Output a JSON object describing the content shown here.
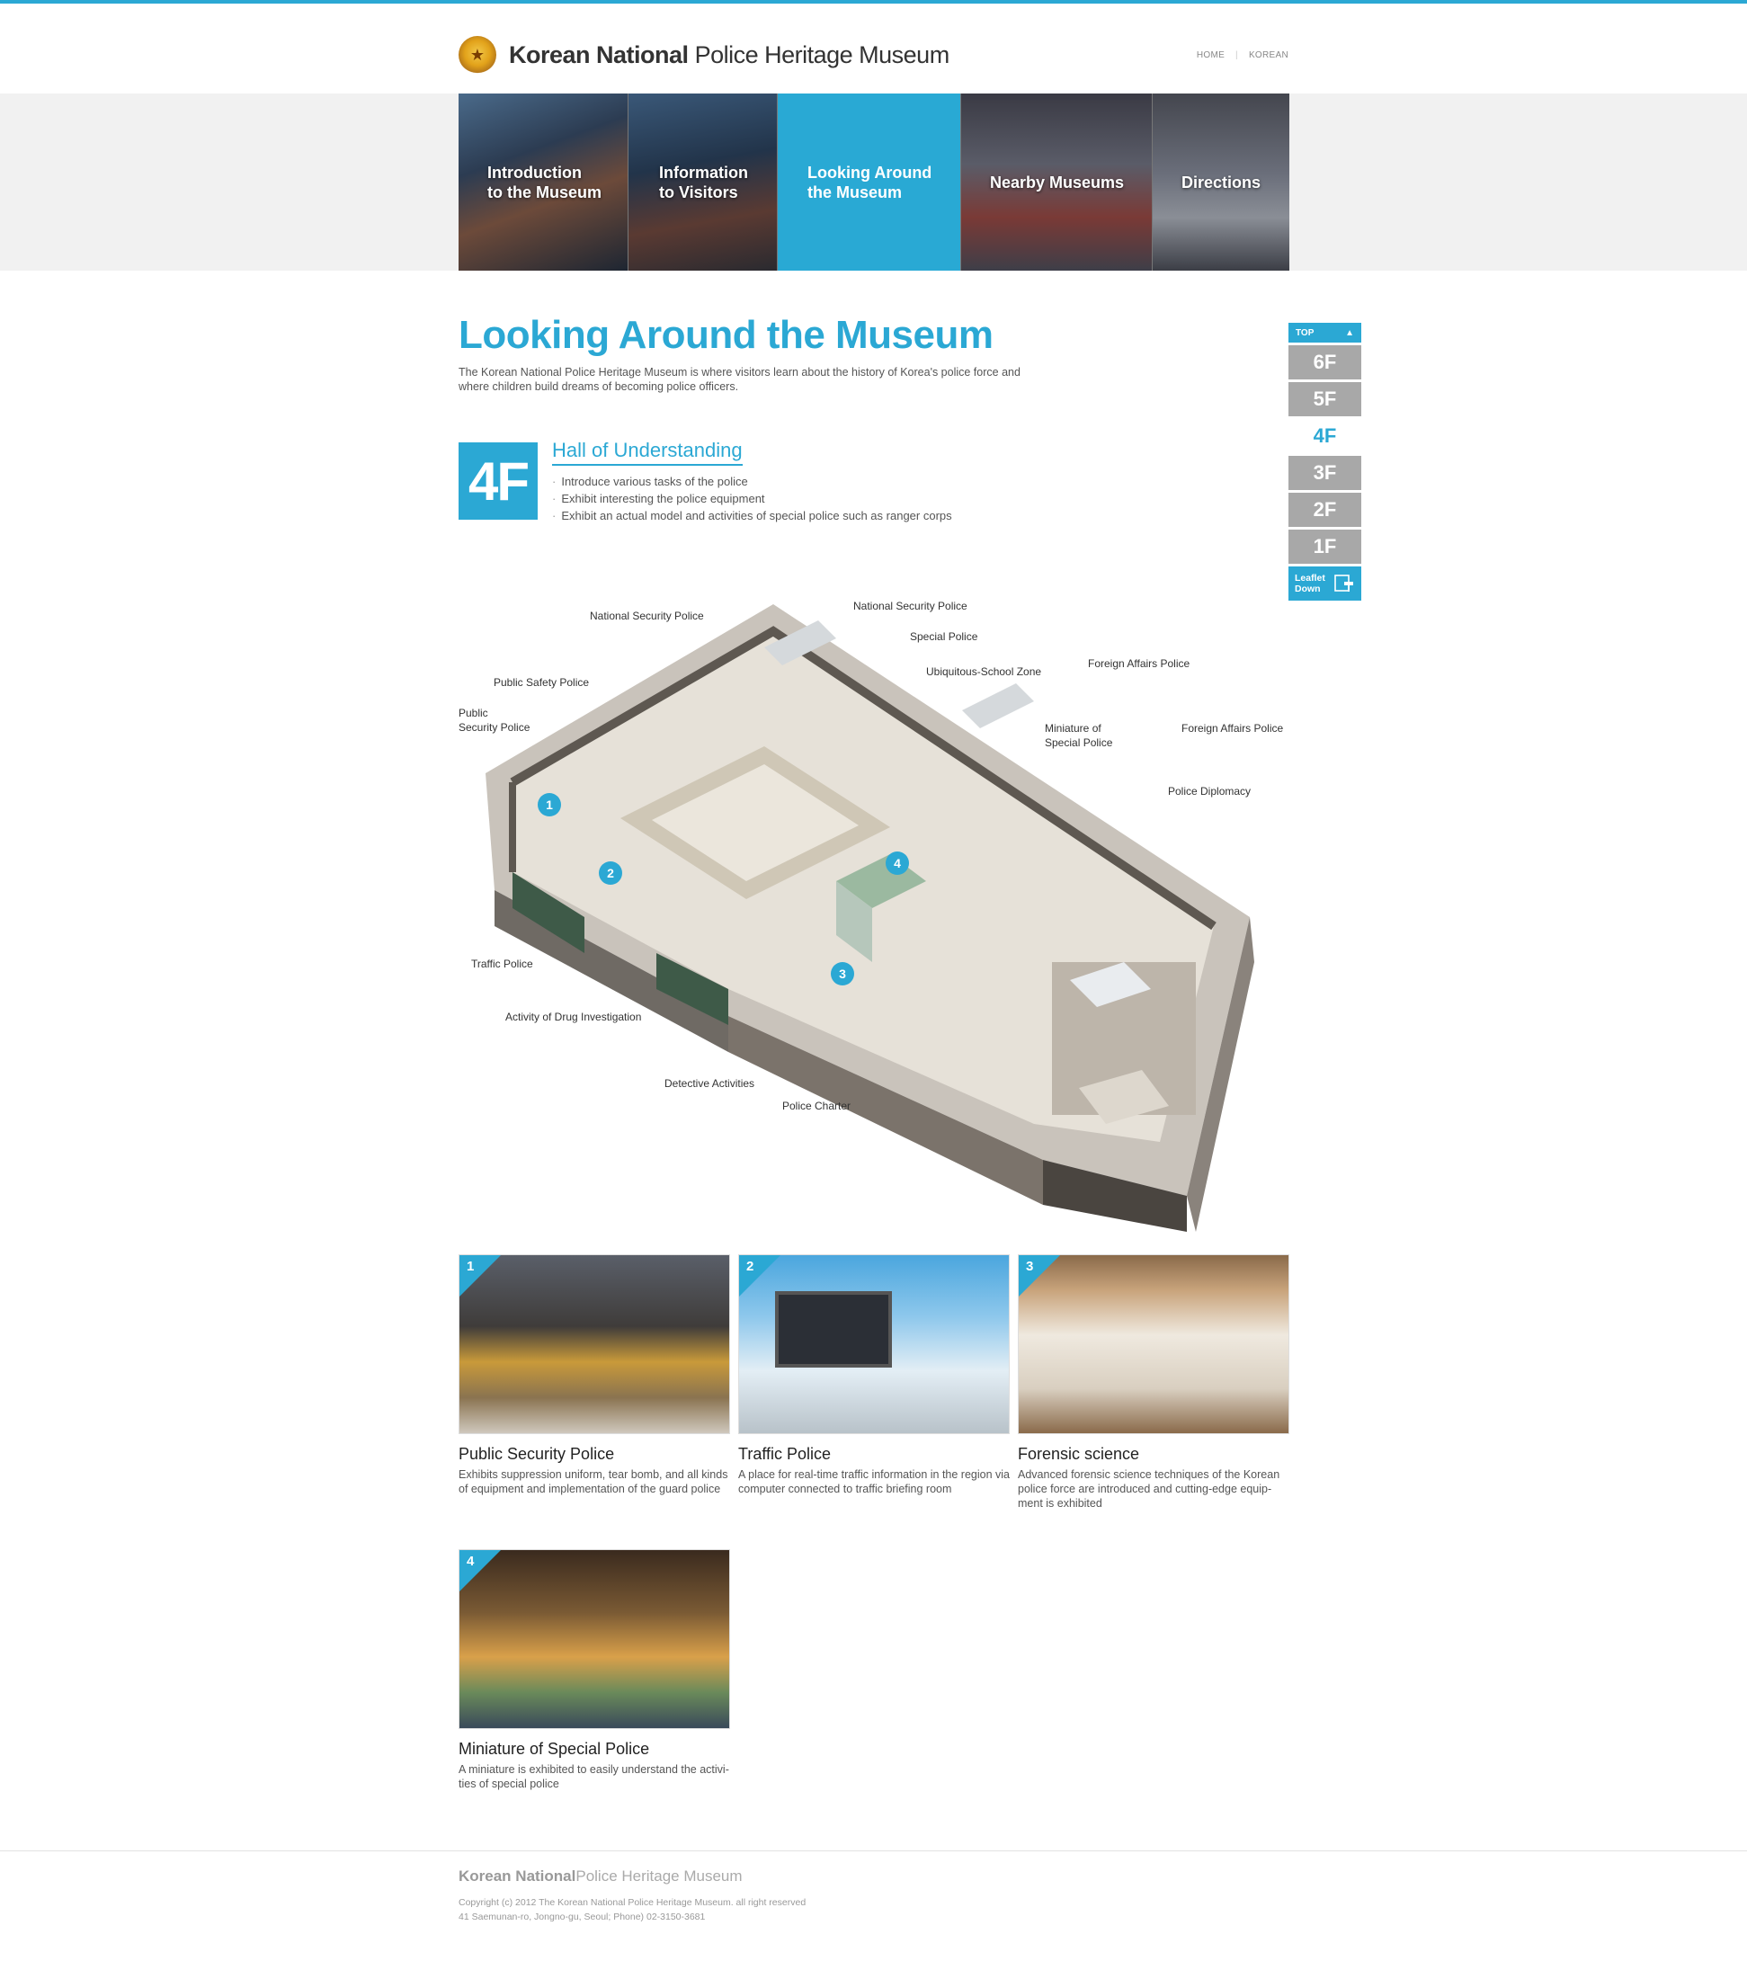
{
  "header": {
    "logo_bold": "Korean National",
    "logo_rest": "Police Heritage Museum",
    "util_links": [
      "HOME",
      "KOREAN"
    ]
  },
  "nav": {
    "items": [
      {
        "label": "Introduction\nto the Museum"
      },
      {
        "label": "Information\nto Visitors"
      },
      {
        "label": "Looking Around\nthe Museum"
      },
      {
        "label": "Nearby Museums"
      },
      {
        "label": "Directions"
      }
    ],
    "active_index": 2
  },
  "main": {
    "title": "Looking Around the Museum",
    "intro": "The Korean National Police Heritage Museum is where visitors learn about the history of Korea's police force and where children build dreams of becoming police officers.",
    "floor": "4F",
    "hall_title": "Hall of Understanding",
    "hall_points": [
      "Introduce various tasks of the police",
      "Exhibit interesting the police equipment",
      "Exhibit an actual model and activities of special police such as ranger corps"
    ]
  },
  "floor_nav": {
    "top_label": "TOP",
    "floors": [
      "6F",
      "5F",
      "4F",
      "3F",
      "2F",
      "1F"
    ],
    "active": "4F",
    "leaflet_label": "Leaflet\nDown"
  },
  "map": {
    "labels": [
      "National Security Police",
      "National Security Police",
      "Special Police",
      "Ubiquitous-School Zone",
      "Foreign Affairs Police",
      "Public Safety Police",
      "Public\nSecurity Police",
      "Miniature of\nSpecial Police",
      "Foreign Affairs Police",
      "Police Diplomacy",
      "Traffic Police",
      "Activity  of Drug Investigation",
      "Detective Activities",
      "Police Charter"
    ],
    "markers": [
      "1",
      "2",
      "3",
      "4"
    ]
  },
  "exhibits": [
    {
      "num": "1",
      "title": "Public Security Police",
      "desc": "Exhibits suppression uniform, tear bomb, and all kinds of equipment and implementation of the guard police"
    },
    {
      "num": "2",
      "title": "Traffic Police",
      "desc": "A place for real-time traffic information in the region via computer connected to traffic briefing room"
    },
    {
      "num": "3",
      "title": "Forensic science",
      "desc": "Advanced forensic science techniques of the Korean police force are introduced and cutting-edge equip-ment is exhibited"
    },
    {
      "num": "4",
      "title": "Miniature of Special Police",
      "desc": "A miniature is exhibited to easily understand the activi-ties of special police"
    }
  ],
  "footer": {
    "logo_bold": "Korean National",
    "logo_rest": "Police Heritage Museum",
    "copyright": "Copyright (c) 2012 The Korean National Police Heritage Museum. all right reserved",
    "address": "41 Saemunan-ro, Jongno-gu, Seoul; Phone) 02-3150-3681"
  },
  "colors": {
    "accent": "#2ba8d4",
    "inactive_floor": "#a8a8a8"
  }
}
